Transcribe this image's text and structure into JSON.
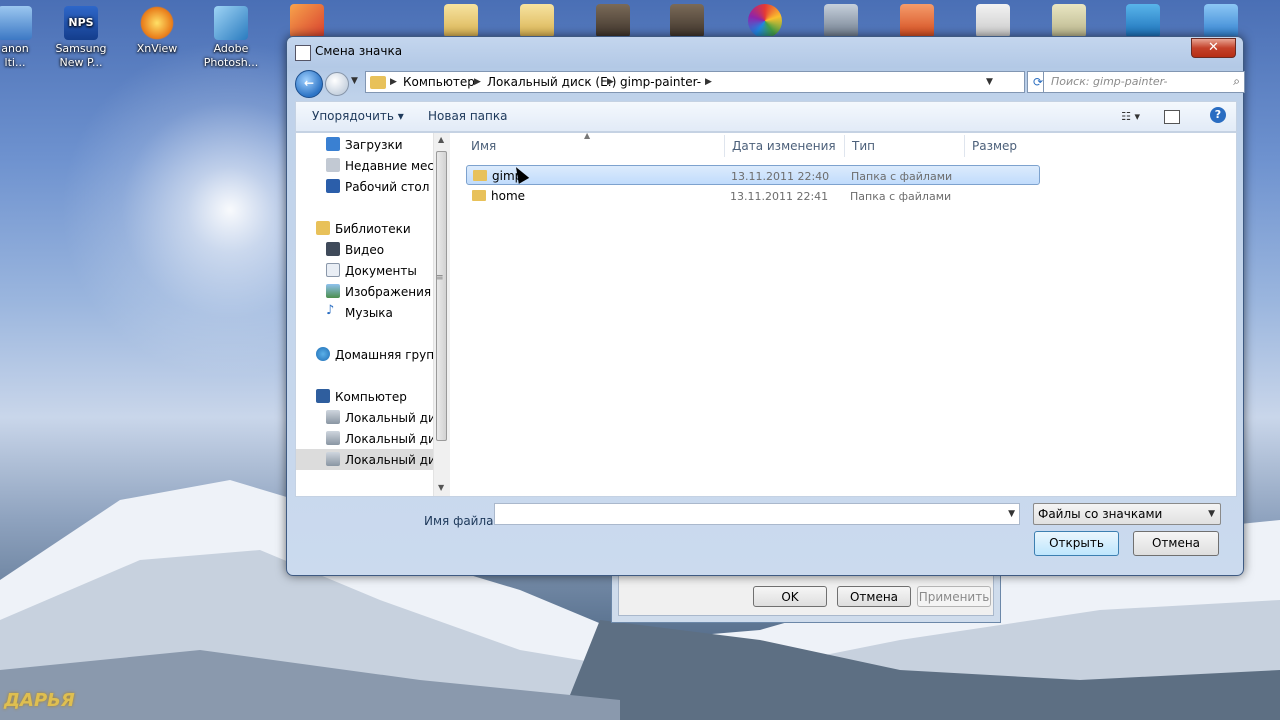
{
  "desktop": {
    "icons": [
      {
        "label": "anon\nlti..."
      },
      {
        "label": "Samsung\nNew P..."
      },
      {
        "label": "XnView"
      },
      {
        "label": "Adobe\nPhotosh..."
      }
    ],
    "watermark": "ДАРЬЯ"
  },
  "bg_dialog": {
    "ok": "OK",
    "cancel": "Отмена",
    "apply": "Применить"
  },
  "dialog": {
    "title": "Смена значка",
    "close": "✕",
    "breadcrumb": [
      "Компьютер",
      "Локальный диск (E:)",
      "gimp-painter-"
    ],
    "search_placeholder": "Поиск: gimp-painter-",
    "toolbar": {
      "organize": "Упорядочить ▾",
      "new_folder": "Новая папка"
    },
    "nav": [
      {
        "label": "Загрузки",
        "icon": "downloads-icon",
        "indent": 1
      },
      {
        "label": "Недавние места",
        "icon": "recent-icon",
        "indent": 1
      },
      {
        "label": "Рабочий стол",
        "icon": "desktop-icon",
        "indent": 1
      },
      {
        "label": "Библиотеки",
        "icon": "libraries-icon",
        "indent": 0
      },
      {
        "label": "Видео",
        "icon": "video-icon",
        "indent": 1
      },
      {
        "label": "Документы",
        "icon": "documents-icon",
        "indent": 1
      },
      {
        "label": "Изображения",
        "icon": "pictures-icon",
        "indent": 1
      },
      {
        "label": "Музыка",
        "icon": "music-icon",
        "indent": 1
      },
      {
        "label": "Домашняя группа",
        "icon": "homegroup-icon",
        "indent": 0
      },
      {
        "label": "Компьютер",
        "icon": "computer-icon",
        "indent": 0
      },
      {
        "label": "Локальный диск",
        "icon": "drive-icon",
        "indent": 1
      },
      {
        "label": "Локальный диск",
        "icon": "drive-icon",
        "indent": 1
      },
      {
        "label": "Локальный диск",
        "icon": "drive-icon",
        "indent": 1,
        "selected": true
      }
    ],
    "columns": [
      "Имя",
      "Дата изменения",
      "Тип",
      "Размер"
    ],
    "files": [
      {
        "name": "gimp",
        "date": "13.11.2011 22:40",
        "type": "Папка с файлами",
        "selected": true
      },
      {
        "name": "home",
        "date": "13.11.2011 22:41",
        "type": "Папка с файлами",
        "selected": false
      }
    ],
    "filename_label": "Имя файла:",
    "filename_value": "",
    "filetype": "Файлы со значками",
    "open": "Открыть",
    "cancel": "Отмена"
  },
  "colors": {
    "selection": "#c1dcfc",
    "title_bar": "#b3c9e6",
    "close_button": "#c4412a"
  }
}
